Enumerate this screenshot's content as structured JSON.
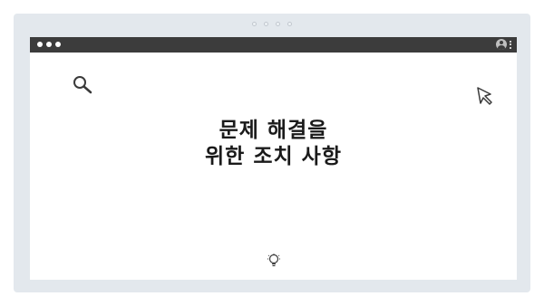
{
  "page": {
    "title_line1": "문제 해결을",
    "title_line2": "위한 조치 사항"
  },
  "icons": {
    "search": "search-icon",
    "cursor": "cursor-icon",
    "bulb": "lightbulb-icon",
    "user": "user-icon",
    "menu": "kebab-menu-icon"
  },
  "colors": {
    "frame": "#e3e8ed",
    "titlebar": "#3c3c3c",
    "content": "#ffffff",
    "text": "#1a1a1a"
  }
}
